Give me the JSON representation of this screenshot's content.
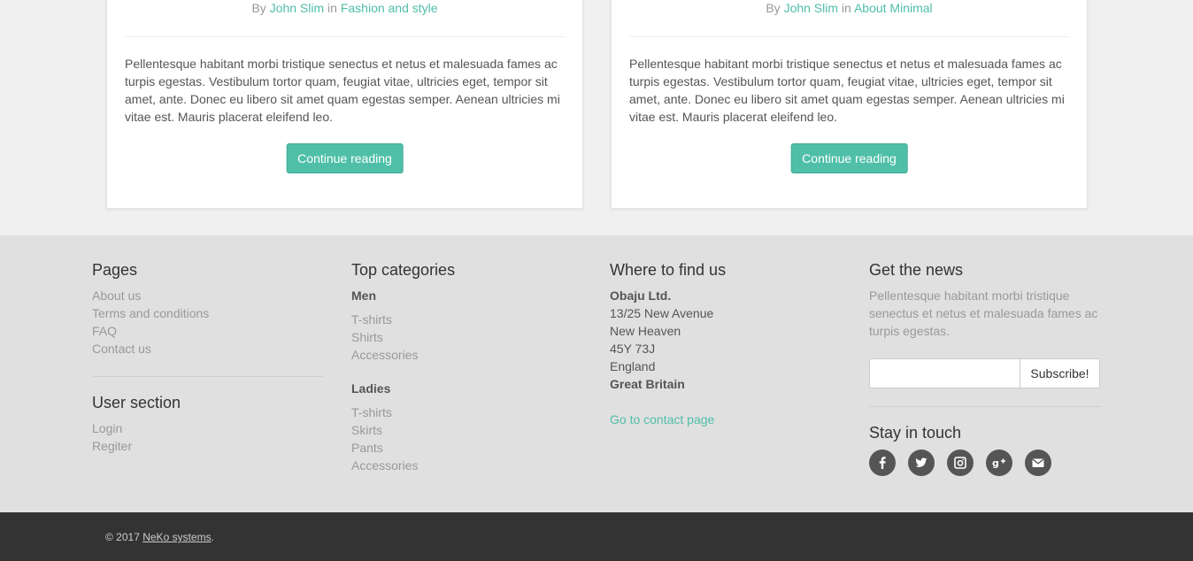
{
  "posts": [
    {
      "meta_by": "By",
      "author": "John Slim",
      "meta_in": "in",
      "category": "Fashion and style",
      "excerpt": "Pellentesque habitant morbi tristique senectus et netus et malesuada fames ac turpis egestas. Vestibulum tortor quam, feugiat vitae, ultricies eget, tempor sit amet, ante. Donec eu libero sit amet quam egestas semper. Aenean ultricies mi vitae est. Mauris placerat eleifend leo.",
      "button": "Continue reading"
    },
    {
      "meta_by": "By",
      "author": "John Slim",
      "meta_in": "in",
      "category": "About Minimal",
      "excerpt": "Pellentesque habitant morbi tristique senectus et netus et malesuada fames ac turpis egestas. Vestibulum tortor quam, feugiat vitae, ultricies eget, tempor sit amet, ante. Donec eu libero sit amet quam egestas semper. Aenean ultricies mi vitae est. Mauris placerat eleifend leo.",
      "button": "Continue reading"
    }
  ],
  "footer": {
    "pages": {
      "title": "Pages",
      "items": [
        "About us",
        "Terms and conditions",
        "FAQ",
        "Contact us"
      ]
    },
    "user_section": {
      "title": "User section",
      "items": [
        "Login",
        "Regiter"
      ]
    },
    "top_categories": {
      "title": "Top categories",
      "men": {
        "title": "Men",
        "items": [
          "T-shirts",
          "Shirts",
          "Accessories"
        ]
      },
      "ladies": {
        "title": "Ladies",
        "items": [
          "T-shirts",
          "Skirts",
          "Pants",
          "Accessories"
        ]
      }
    },
    "where": {
      "title": "Where to find us",
      "company": "Obaju Ltd.",
      "street": "13/25 New Avenue",
      "city": "New Heaven",
      "postcode": "45Y 73J",
      "region": "England",
      "country": "Great Britain",
      "contact_link": "Go to contact page"
    },
    "news": {
      "title": "Get the news",
      "text": "Pellentesque habitant morbi tristique senectus et netus et malesuada fames ac turpis egestas.",
      "input_value": "",
      "subscribe": "Subscribe!"
    },
    "stay": {
      "title": "Stay in touch",
      "icons": [
        "facebook-icon",
        "twitter-icon",
        "instagram-icon",
        "google-plus-icon",
        "envelope-icon"
      ]
    }
  },
  "copyright": {
    "prefix": "© 2017",
    "company": "NeKo systems",
    "suffix": "."
  },
  "colors": {
    "accent": "#4fbfa8",
    "footer_bg": "#e0e0e0",
    "copyright_bg": "#333333"
  }
}
